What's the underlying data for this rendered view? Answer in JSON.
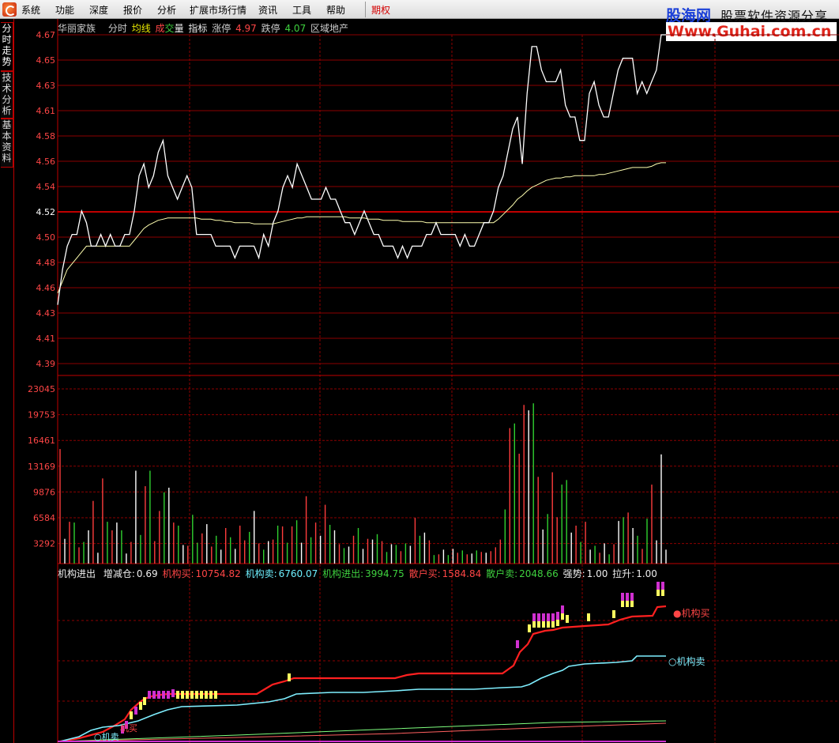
{
  "menu": {
    "items": [
      "系统",
      "功能",
      "深度",
      "报价",
      "分析",
      "扩展市场行情",
      "资讯",
      "工具",
      "帮助"
    ],
    "special": "期权"
  },
  "watermark": {
    "brand": "股海网",
    "tagline": "股票软件资源分享",
    "url": "Www.Guhai.com.cn"
  },
  "side_tabs": [
    "分时走势",
    "技术分析",
    "基本资料"
  ],
  "header": {
    "stock_name": "华丽家族",
    "label_fenshi": "分时",
    "label_junxian": "均线",
    "label_cheng": "成",
    "label_jiao": "交",
    "label_liang": "量",
    "label_zhibiao": "指标",
    "label_zhangting": "涨停",
    "zhangting": "4.97",
    "label_dieting": "跌停",
    "dieting": "4.07",
    "sector": "区域地产"
  },
  "indicator": {
    "name": "机构进出",
    "zengjiancang_label": "增减仓:",
    "zengjiancang": "0.69",
    "jigoumai_label": "机构买:",
    "jigoumai": "10754.82",
    "jigoumaichu_label": "机构卖:",
    "jigoumaichu": "6760.07",
    "jigoujinchu_label": "机构进出:",
    "jigoujinchu": "3994.75",
    "sanhumai_label": "散户买:",
    "sanhumai": "1584.84",
    "sanhumaichu_label": "散户卖:",
    "sanhumaichu": "2048.66",
    "qiangshi_label": "强势:",
    "qiangshi": "1.00",
    "lasheng_label": "拉升:",
    "lasheng": "1.00",
    "end_label_buy": "机构买",
    "end_label_sell": "机构卖",
    "start_label_buy": "机买",
    "start_label_sell": "机卖"
  },
  "colors": {
    "grid": "#8b0000",
    "price_line": "#ffffff",
    "avg_line": "#ffffb0",
    "vol_up": "#ff3c3c",
    "vol_down": "#2fd12f",
    "vol_flat": "#ffffff",
    "inst_buy": "#ff2020",
    "inst_sell": "#7fefff",
    "retail_buy": "#ff6060",
    "retail_sell": "#7fff7f",
    "marker_yellow": "#ffff60",
    "marker_magenta": "#d030d0"
  },
  "chart_data": [
    {
      "type": "line",
      "name": "price",
      "y_ticks": [
        "4.67",
        "4.65",
        "4.63",
        "4.61",
        "4.58",
        "4.56",
        "4.54",
        "4.52",
        "4.50",
        "4.48",
        "4.46",
        "4.43",
        "4.41",
        "4.39"
      ],
      "ylim": [
        4.39,
        4.67
      ],
      "series": [
        {
          "name": "分时",
          "values": [
            4.44,
            4.47,
            4.49,
            4.5,
            4.5,
            4.52,
            4.51,
            4.49,
            4.49,
            4.5,
            4.49,
            4.5,
            4.49,
            4.49,
            4.5,
            4.5,
            4.52,
            4.55,
            4.56,
            4.54,
            4.55,
            4.57,
            4.58,
            4.55,
            4.54,
            4.53,
            4.54,
            4.55,
            4.54,
            4.5,
            4.5,
            4.5,
            4.5,
            4.49,
            4.49,
            4.49,
            4.49,
            4.48,
            4.49,
            4.49,
            4.49,
            4.49,
            4.48,
            4.5,
            4.49,
            4.51,
            4.52,
            4.54,
            4.55,
            4.54,
            4.56,
            4.55,
            4.54,
            4.53,
            4.53,
            4.53,
            4.54,
            4.53,
            4.53,
            4.52,
            4.51,
            4.51,
            4.5,
            4.51,
            4.52,
            4.51,
            4.5,
            4.5,
            4.49,
            4.49,
            4.49,
            4.48,
            4.49,
            4.48,
            4.49,
            4.49,
            4.49,
            4.5,
            4.5,
            4.51,
            4.5,
            4.5,
            4.5,
            4.5,
            4.49,
            4.5,
            4.49,
            4.49,
            4.5,
            4.51,
            4.51,
            4.52,
            4.54,
            4.55,
            4.57,
            4.59,
            4.6,
            4.56,
            4.62,
            4.66,
            4.66,
            4.64,
            4.63,
            4.63,
            4.63,
            4.64,
            4.61,
            4.6,
            4.6,
            4.58,
            4.58,
            4.62,
            4.63,
            4.61,
            4.6,
            4.6,
            4.62,
            4.64,
            4.65,
            4.65,
            4.65,
            4.62,
            4.63,
            4.62,
            4.63,
            4.64,
            4.67,
            4.67
          ]
        },
        {
          "name": "均线",
          "values": [
            4.45,
            4.46,
            4.47,
            4.475,
            4.48,
            4.485,
            4.49,
            4.49,
            4.49,
            4.49,
            4.49,
            4.49,
            4.49,
            4.49,
            4.49,
            4.49,
            4.495,
            4.5,
            4.505,
            4.508,
            4.51,
            4.512,
            4.513,
            4.514,
            4.514,
            4.514,
            4.514,
            4.514,
            4.514,
            4.514,
            4.513,
            4.513,
            4.513,
            4.512,
            4.512,
            4.511,
            4.511,
            4.51,
            4.51,
            4.51,
            4.51,
            4.509,
            4.509,
            4.509,
            4.509,
            4.509,
            4.51,
            4.511,
            4.512,
            4.513,
            4.514,
            4.514,
            4.515,
            4.515,
            4.515,
            4.515,
            4.515,
            4.515,
            4.515,
            4.515,
            4.515,
            4.514,
            4.514,
            4.514,
            4.514,
            4.513,
            4.513,
            4.513,
            4.512,
            4.512,
            4.512,
            4.512,
            4.511,
            4.511,
            4.511,
            4.511,
            4.511,
            4.51,
            4.51,
            4.51,
            4.51,
            4.51,
            4.51,
            4.51,
            4.51,
            4.51,
            4.51,
            4.51,
            4.51,
            4.51,
            4.51,
            4.51,
            4.513,
            4.517,
            4.521,
            4.525,
            4.53,
            4.533,
            4.537,
            4.54,
            4.542,
            4.544,
            4.546,
            4.547,
            4.548,
            4.548,
            4.549,
            4.549,
            4.55,
            4.55,
            4.55,
            4.55,
            4.55,
            4.551,
            4.551,
            4.552,
            4.553,
            4.554,
            4.555,
            4.556,
            4.557,
            4.557,
            4.557,
            4.557,
            4.558,
            4.56,
            4.561,
            4.561
          ]
        }
      ]
    },
    {
      "type": "bar",
      "name": "volume",
      "y_ticks": [
        "23045",
        "19753",
        "16461",
        "13169",
        "9876",
        "6584",
        "3292"
      ],
      "ylim": [
        0,
        24000
      ]
    },
    {
      "type": "line",
      "name": "机构进出",
      "series": [
        "机构买",
        "机构卖",
        "散户买",
        "散户卖"
      ]
    }
  ]
}
